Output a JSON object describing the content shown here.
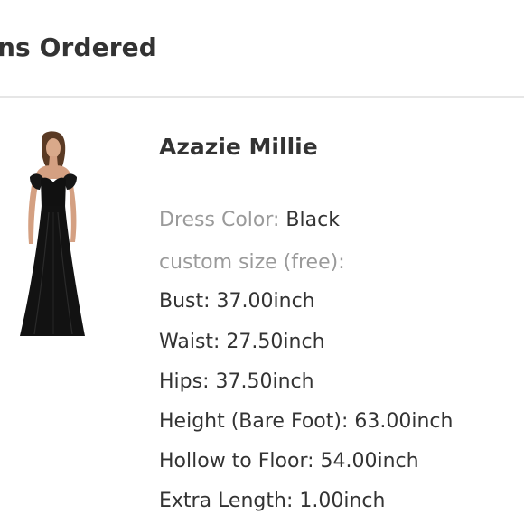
{
  "header": {
    "title": "ns Ordered"
  },
  "item": {
    "name": "Azazie Millie",
    "dress_color_label": "Dress Color:",
    "dress_color_value": "Black",
    "custom_size_label": "custom size (free):",
    "measurements": [
      "Bust: 37.00inch",
      "Waist: 27.50inch",
      "Hips: 37.50inch",
      "Height (Bare Foot): 63.00inch",
      "Hollow to Floor: 54.00inch",
      "Extra Length: 1.00inch"
    ]
  }
}
